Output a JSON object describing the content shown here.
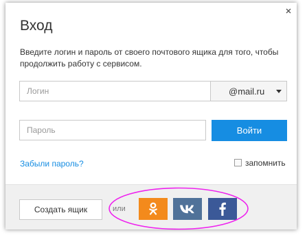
{
  "dialog": {
    "title": "Вход",
    "subtitle": "Введите логин и пароль от своего почтового ящика для того, чтобы продолжить работу с сервисом.",
    "close_icon": "close-icon"
  },
  "login": {
    "placeholder": "Логин",
    "value": "",
    "domain_selected": "@mail.ru"
  },
  "password": {
    "placeholder": "Пароль",
    "value": ""
  },
  "login_button": {
    "label": "Войти",
    "color": "#168de2"
  },
  "forgot_password_link": "Забыли пароль?",
  "remember_me": {
    "label": "запомнить",
    "checked": false
  },
  "footer": {
    "create_mailbox_label": "Создать ящик",
    "or_label": "или",
    "social_buttons": [
      {
        "network": "odnoklassniki",
        "icon": "odnoklassniki-icon",
        "color": "#f38a1c"
      },
      {
        "network": "vkontakte",
        "icon": "vk-icon",
        "color": "#507299"
      },
      {
        "network": "facebook",
        "icon": "facebook-icon",
        "color": "#3b5998"
      }
    ]
  },
  "annotation": {
    "type": "ellipse",
    "color": "#ee22ee"
  }
}
